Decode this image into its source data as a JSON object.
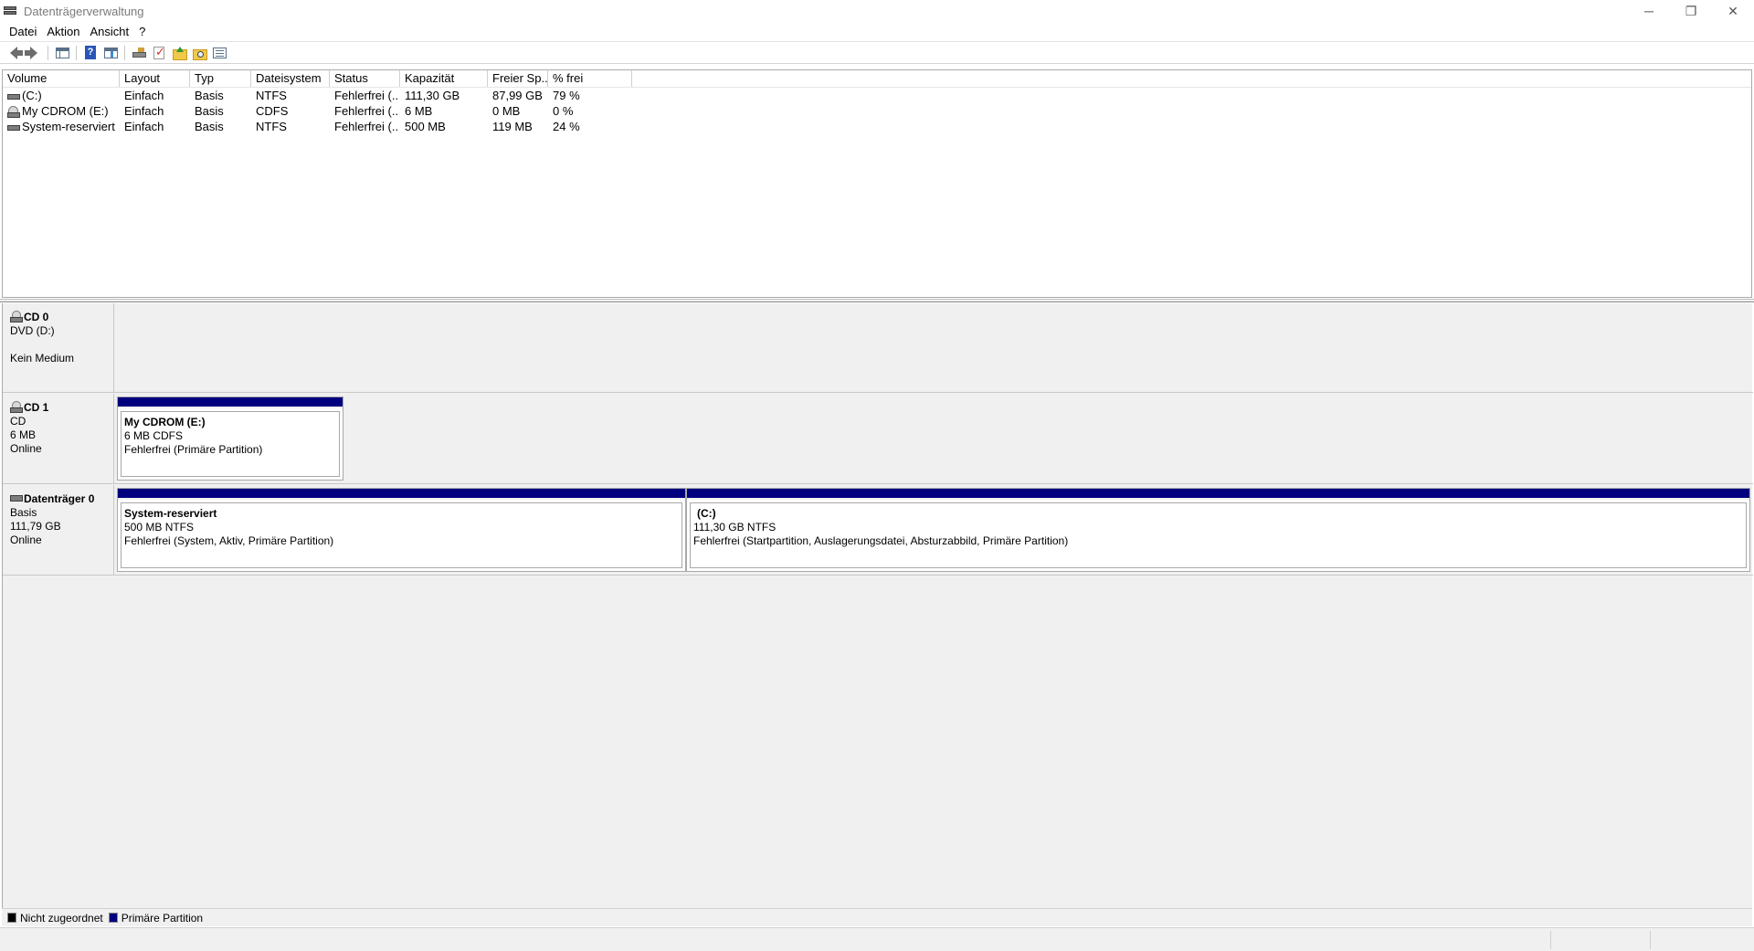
{
  "window": {
    "title": "Datenträgerverwaltung",
    "controls": {
      "minimize": "─",
      "restore": "❐",
      "close": "✕"
    }
  },
  "menu": [
    "Datei",
    "Aktion",
    "Ansicht",
    "?"
  ],
  "toolbar": {
    "icons": [
      "back-icon",
      "forward-icon",
      "console-tree-icon",
      "help-icon",
      "properties-icon",
      "disk-icon",
      "check-icon",
      "folder-up-icon",
      "folder-search-icon",
      "view-icon"
    ]
  },
  "volume_list": {
    "columns": [
      "Volume",
      "Layout",
      "Typ",
      "Dateisystem",
      "Status",
      "Kapazität",
      "Freier Sp...",
      "% frei"
    ],
    "rows": [
      {
        "icon": "hard-disk-icon",
        "volume": "(C:)",
        "layout": "Einfach",
        "typ": "Basis",
        "fs": "NTFS",
        "status": "Fehlerfrei (...",
        "kapazitaet": "111,30 GB",
        "frei": "87,99 GB",
        "pct": "79 %"
      },
      {
        "icon": "cdrom-icon",
        "volume": "My CDROM (E:)",
        "layout": "Einfach",
        "typ": "Basis",
        "fs": "CDFS",
        "status": "Fehlerfrei (...",
        "kapazitaet": "6 MB",
        "frei": "0 MB",
        "pct": "0 %"
      },
      {
        "icon": "hard-disk-icon",
        "volume": "System-reserviert",
        "layout": "Einfach",
        "typ": "Basis",
        "fs": "NTFS",
        "status": "Fehlerfrei (...",
        "kapazitaet": "500 MB",
        "frei": "119 MB",
        "pct": "24 %"
      }
    ]
  },
  "disks": [
    {
      "name": "CD 0",
      "line1": "DVD (D:)",
      "line2": "",
      "line3": "Kein Medium",
      "partitions": []
    },
    {
      "name": "CD 1",
      "line1": "CD",
      "line2": "6 MB",
      "line3": "Online",
      "partitions": [
        {
          "name": "My CDROM  (E:)",
          "size": "6 MB CDFS",
          "status": "Fehlerfrei (Primäre Partition)"
        }
      ]
    },
    {
      "name": "Datenträger 0",
      "line1": "Basis",
      "line2": "111,79 GB",
      "line3": "Online",
      "partitions": [
        {
          "name": "System-reserviert",
          "size": "500 MB NTFS",
          "status": "Fehlerfrei (System, Aktiv, Primäre Partition)"
        },
        {
          "name": "(C:)",
          "size": "111,30 GB NTFS",
          "status": "Fehlerfrei (Startpartition, Auslagerungsdatei, Absturzabbild, Primäre Partition)"
        }
      ]
    }
  ],
  "legend": [
    {
      "label": "Nicht zugeordnet",
      "color": "#000000"
    },
    {
      "label": "Primäre Partition",
      "color": "#00007f"
    }
  ]
}
